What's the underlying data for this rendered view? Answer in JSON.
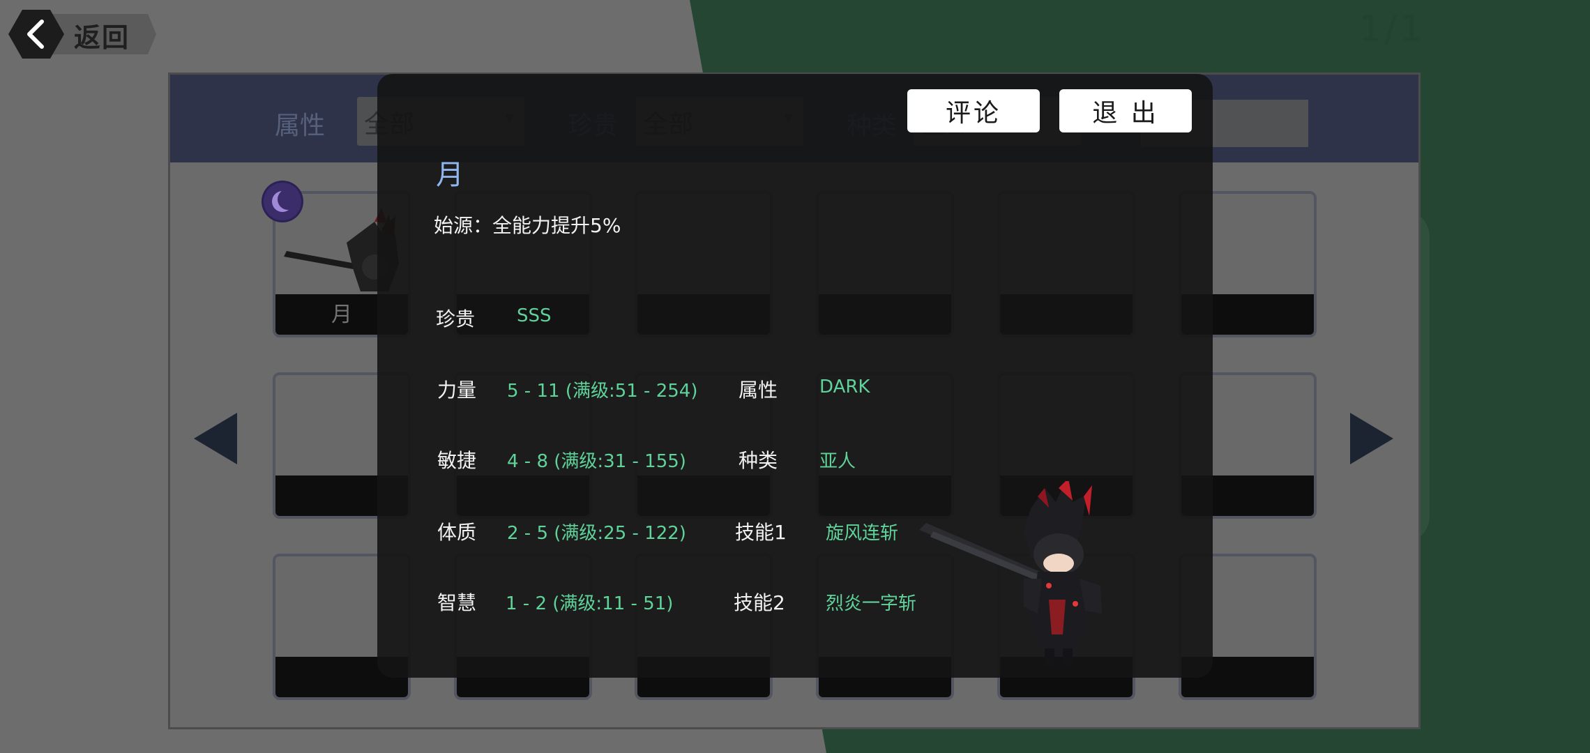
{
  "background": {
    "page_indicator": "1/1"
  },
  "back_button": {
    "label": "返回"
  },
  "filters": {
    "attribute_label": "属性",
    "attribute_value": "全部",
    "rarity_label": "珍贵",
    "rarity_value": "全部",
    "type_label": "种类",
    "type_value": "全部",
    "search_value": ""
  },
  "grid": {
    "first_card_label": "月",
    "rows": 3,
    "columns": 6
  },
  "detail": {
    "comment_button": "评论",
    "exit_button": "退 出",
    "name": "月",
    "origin": "始源：全能力提升5%",
    "rarity_label": "珍贵",
    "rarity_value": "SSS",
    "stats": [
      {
        "label": "力量",
        "value": "5 - 11 (满级:51 - 254)"
      },
      {
        "label": "敏捷",
        "value": "4 - 8 (满级:31 - 155)"
      },
      {
        "label": "体质",
        "value": "2 - 5 (满级:25 - 122)"
      },
      {
        "label": "智慧",
        "value": "1 - 2 (满级:11 - 51)"
      }
    ],
    "info": [
      {
        "label": "属性",
        "value": "DARK"
      },
      {
        "label": "种类",
        "value": "亚人"
      },
      {
        "label": "技能1",
        "value": "旋风连斩"
      },
      {
        "label": "技能2",
        "value": "烈炎一字斩"
      }
    ]
  },
  "colors": {
    "accent_green": "#5fd39a",
    "name_blue": "#8fb6ef",
    "filter_bar": "#2e3349",
    "scene_green": "#244632"
  },
  "icons": [
    "back-chevron-icon",
    "moon-icon",
    "left-arrow-icon",
    "right-arrow-icon"
  ]
}
